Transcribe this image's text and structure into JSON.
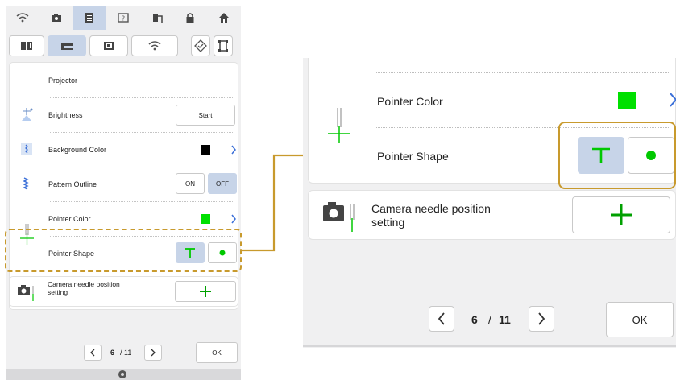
{
  "left_panel": {
    "top_toolbar_icons": [
      "wifi-icon",
      "camera-icon",
      "page-icon",
      "help-icon",
      "thread-icon",
      "lock-icon",
      "home-icon"
    ],
    "second_toolbar_icons": [
      "book-icon",
      "sewing-machine-icon",
      "embroidery-icon",
      "wifi-icon",
      "settings-icon",
      "frame-icon"
    ],
    "rows": {
      "projector": "Projector",
      "brightness": "Brightness",
      "brightness_button": "Start",
      "background_color": "Background Color",
      "pattern_outline": "Pattern Outline",
      "on": "ON",
      "off": "OFF",
      "pointer_color": "Pointer Color",
      "pointer_shape": "Pointer Shape",
      "camera_needle": "Camera needle position setting"
    },
    "pager": {
      "current": "6",
      "total": "/ 11",
      "ok": "OK"
    }
  },
  "right_panel": {
    "pointer_color": "Pointer Color",
    "pointer_shape": "Pointer Shape",
    "camera_needle_line1": "Camera needle position",
    "camera_needle_line2": "setting",
    "pager": {
      "current": "6",
      "separator": "/",
      "total": "11",
      "ok": "OK"
    }
  },
  "colors": {
    "pointer_green": "#00e000",
    "background_swatch": "#000000",
    "highlight_gold": "#c89a2d",
    "selected_blue": "#c7d4e8",
    "chevron_blue": "#3a6fd8"
  }
}
